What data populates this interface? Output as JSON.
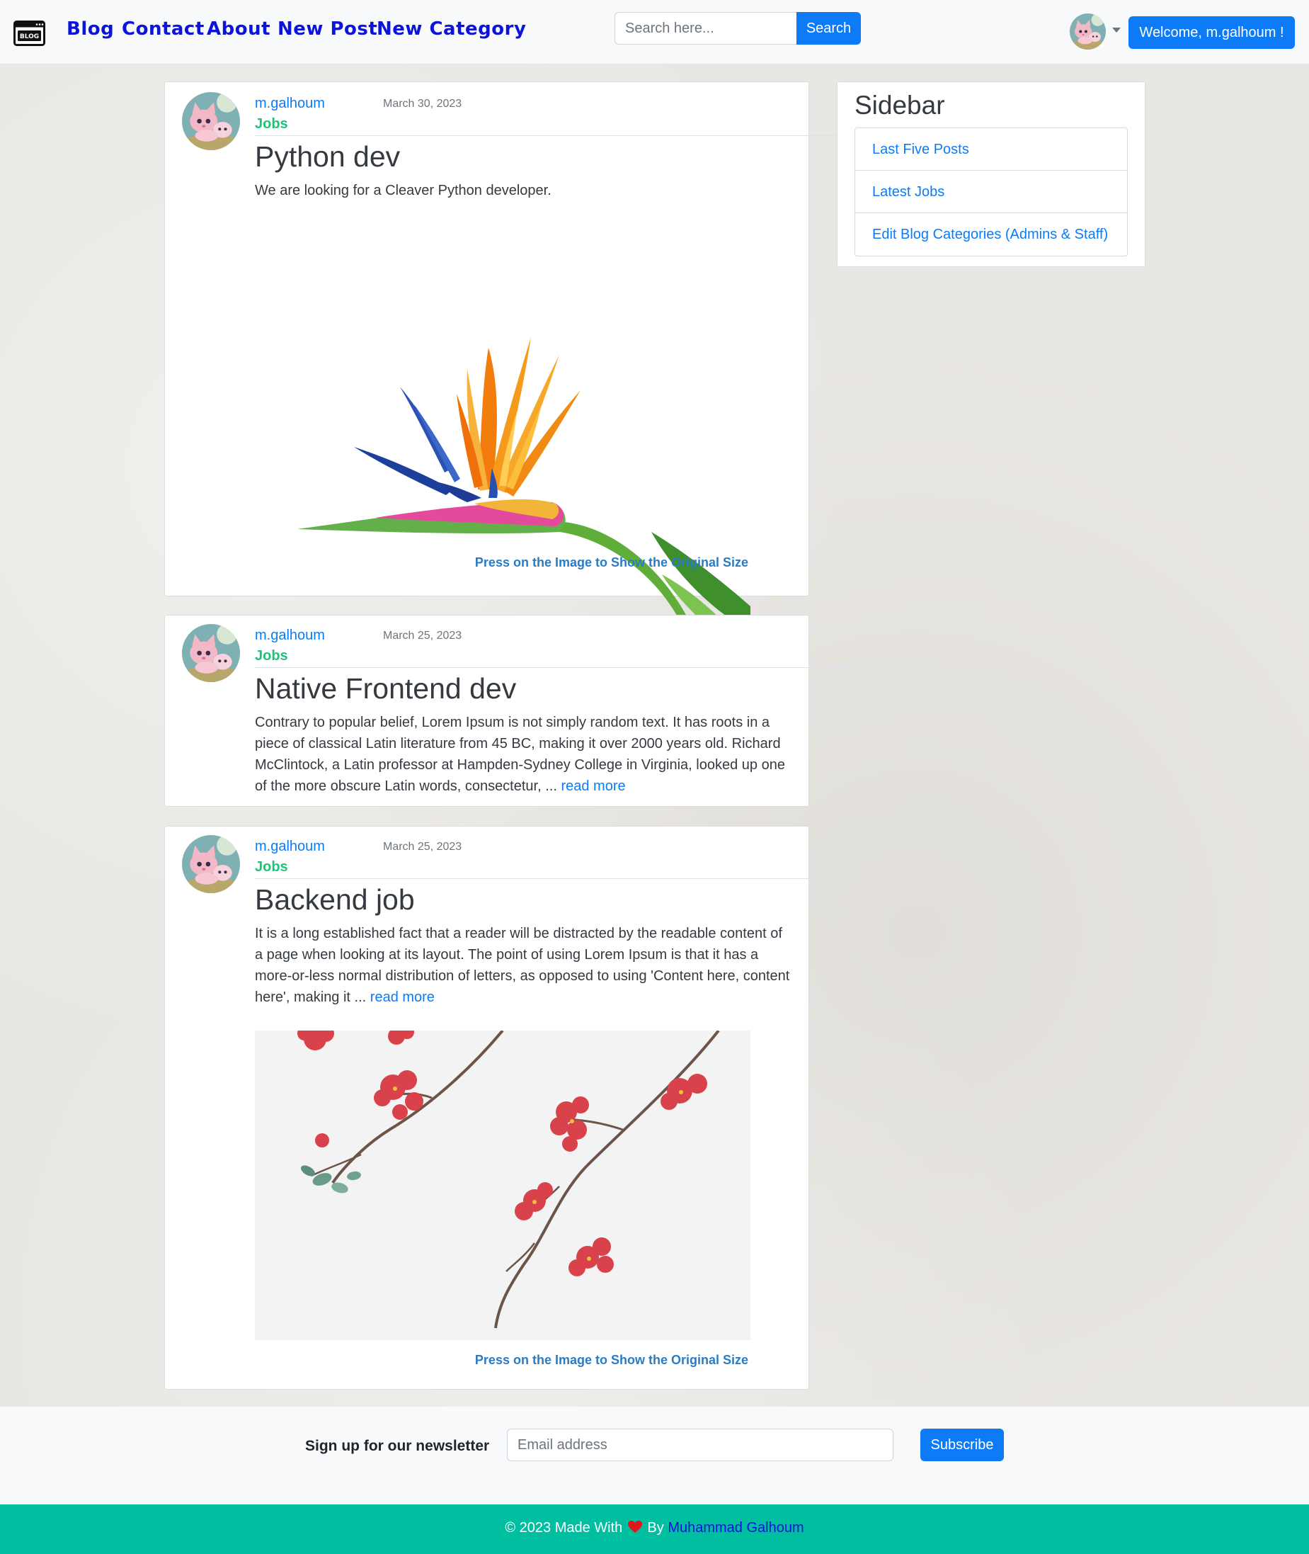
{
  "navbar": {
    "brand_icon": "blog-logo-icon",
    "brand_icon_text": "BLOG",
    "links": [
      "Blog",
      "Contact",
      "About",
      "New Post",
      "New Category"
    ],
    "search": {
      "placeholder": "Search here...",
      "button_label": "Search"
    },
    "welcome_label": "Welcome, m.galhoum !",
    "avatar_icon": "cat-avatar-icon"
  },
  "posts": [
    {
      "author": "m.galhoum",
      "date": "March 30, 2023",
      "category": "Jobs",
      "title": "Python dev",
      "body": "We are looking for a Cleaver Python developer.",
      "read_more": "",
      "image": "bird-of-paradise-flower-image",
      "image_hint": "Press on the Image to Show the Original Size"
    },
    {
      "author": "m.galhoum",
      "date": "March 25, 2023",
      "category": "Jobs",
      "title": "Native Frontend dev",
      "body": "Contrary to popular belief, Lorem Ipsum is not simply random text. It has roots in a piece of classical Latin literature from 45 BC, making it over 2000 years old. Richard McClintock, a Latin professor at Hampden-Sydney College in Virginia, looked up one of the more obscure Latin words, consectetur, ...",
      "read_more": "read more"
    },
    {
      "author": "m.galhoum",
      "date": "March 25, 2023",
      "category": "Jobs",
      "title": "Backend job",
      "body": "It is a long established fact that a reader will be distracted by the readable content of a page when looking at its layout. The point of using Lorem Ipsum is that it has a more-or-less normal distribution of letters, as opposed to using 'Content here, content here', making it ...",
      "read_more": "read more",
      "image": "red-blossom-branch-image",
      "image_hint": "Press on the Image to Show the Original Size"
    }
  ],
  "sidebar": {
    "title": "Sidebar",
    "items": [
      "Last Five Posts",
      "Latest Jobs",
      "Edit Blog Categories (Admins & Staff)"
    ]
  },
  "newsletter": {
    "label": "Sign up for our newsletter",
    "placeholder": "Email address",
    "button_label": "Subscribe"
  },
  "footer": {
    "prefix": "© 2023 Made With",
    "heart_icon": "heart-icon",
    "by": "By",
    "author_link": "Muhammad Galhoum"
  },
  "colors": {
    "link_blue": "#0d7bf5",
    "nav_blue": "#0d14d9",
    "category_green": "#20c27a",
    "footer_teal": "#00bfa0"
  }
}
